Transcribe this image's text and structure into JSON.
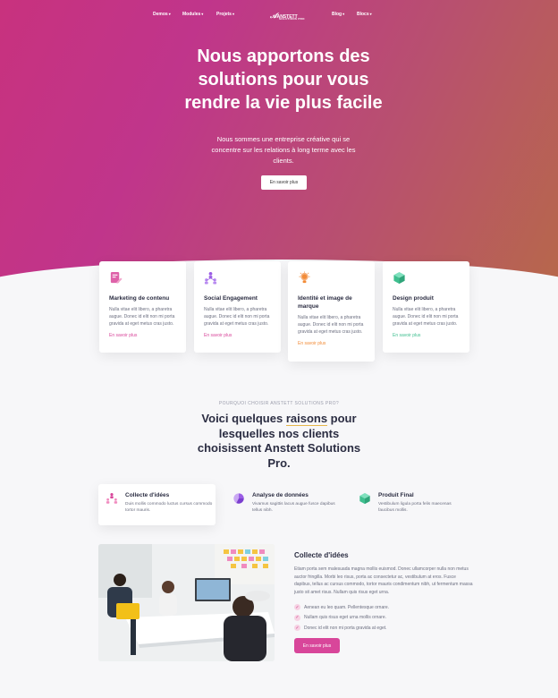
{
  "nav": {
    "left": [
      "Demos",
      "Modules",
      "Projets"
    ],
    "right": [
      "Blog",
      "Blocs"
    ],
    "logo_text": "ANSTETT",
    "logo_sub": "SOLUTIONS PRO"
  },
  "hero": {
    "title": "Nous apportons des solutions pour vous rendre la vie plus facile",
    "subtitle": "Nous sommes une entreprise créative qui se concentre sur les relations à long terme avec les clients.",
    "button": "En savoir plus"
  },
  "services": [
    {
      "title": "Marketing de contenu",
      "text": "Nulla vitae elit libero, a pharetra augue. Donec id elit non mi porta gravida at eget metus cras justo.",
      "link": "En savoir plus",
      "icon": "document-edit-icon",
      "color": "#d8469a"
    },
    {
      "title": "Social Engagement",
      "text": "Nulla vitae elit libero, a pharetra augue. Donec id elit non mi porta gravida at eget metus cras justo.",
      "link": "En savoir plus",
      "icon": "network-icon",
      "color": "#9b5de5"
    },
    {
      "title": "Identité et image de marque",
      "text": "Nulla vitae elit libero, a pharetra augue. Donec id elit non mi porta gravida at eget metus cras justo.",
      "link": "En savoir plus",
      "icon": "lightbulb-icon",
      "color": "#f28c38"
    },
    {
      "title": "Design produit",
      "text": "Nulla vitae elit libero, a pharetra augue. Donec id elit non mi porta gravida at eget metus cras justo.",
      "link": "En savoir plus",
      "icon": "cube-icon",
      "color": "#3fbf8f"
    }
  ],
  "why": {
    "eyebrow": "POURQUOI CHOISIR ANSTETT SOLUTIONS PRO?",
    "heading_pre": "Voici quelques ",
    "heading_hl": "raisons",
    "heading_post": " pour lesquelles nos clients choisissent Anstett Solutions Pro."
  },
  "features": [
    {
      "title": "Collecte d'idées",
      "text": "Duis mollis commodo luctus cursus commodo tortor mauris.",
      "icon": "team-icon",
      "color": "#d8469a"
    },
    {
      "title": "Analyse de données",
      "text": "Vivamus sagittis lacus augue fusce dapibus tellus nibh.",
      "icon": "pie-chart-icon",
      "color": "#9b5de5"
    },
    {
      "title": "Produit Final",
      "text": "Vestibulum ligula porta felis maecenas faucibus mollis.",
      "icon": "box-icon",
      "color": "#3fbf8f"
    }
  ],
  "detail": {
    "title": "Collecte d'idées",
    "text": "Etiam porta sem malesuada magna mollis euismod. Donec ullamcorper nulla non metus auctor fringilla. Morbi leo risus, porta ac consectetur ac, vestibulum at eros. Fusce dapibus, tellus ac cursus commodo, tortor mauris condimentum nibh, ut fermentum massa justo sit amet risus. Nullam quis risus eget urna.",
    "checks": [
      "Aenean eu leo quam. Pellentesque ornare.",
      "Nullam quis risus eget urna mollis ornare.",
      "Donec id elit non mi porta gravida at eget."
    ],
    "button": "En savoir plus"
  }
}
